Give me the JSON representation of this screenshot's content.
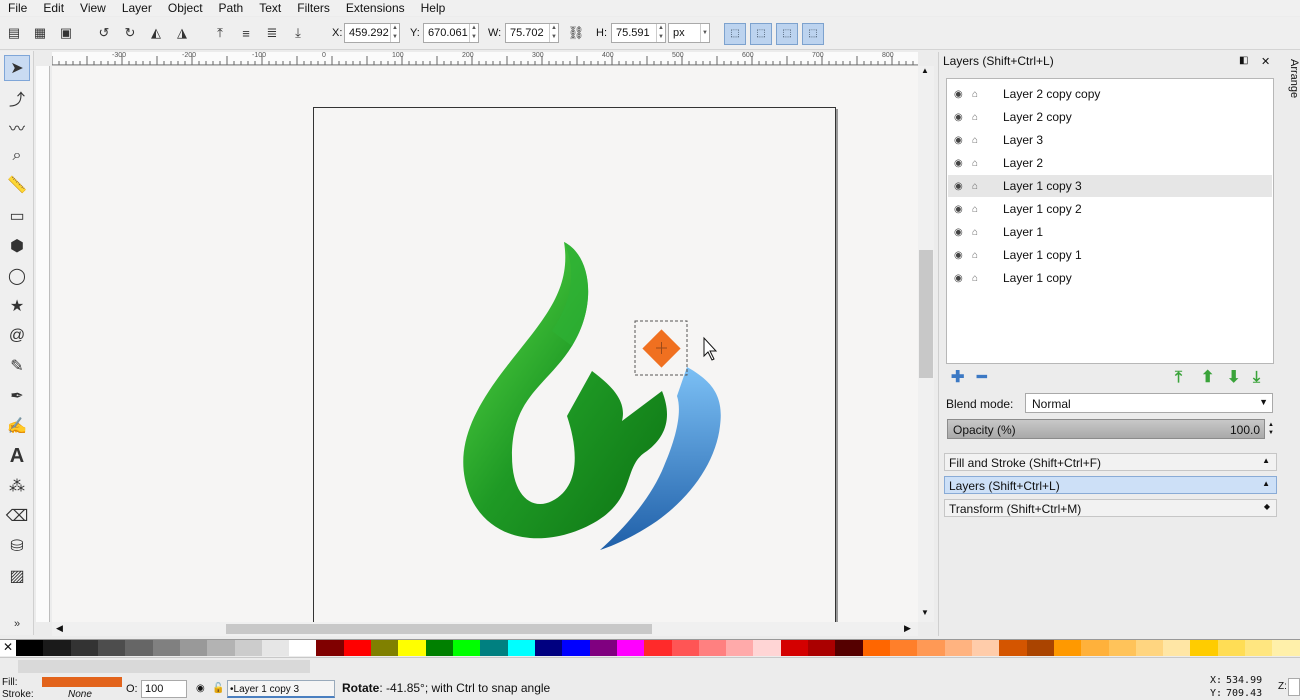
{
  "menu": [
    "File",
    "Edit",
    "View",
    "Layer",
    "Object",
    "Path",
    "Text",
    "Filters",
    "Extensions",
    "Help"
  ],
  "toolbar": {
    "x_label": "X:",
    "x_value": "459.292",
    "y_label": "Y:",
    "y_value": "670.061",
    "w_label": "W:",
    "w_value": "75.702",
    "h_label": "H:",
    "h_value": "75.591",
    "unit": "px"
  },
  "ruler_marks": [
    "-300",
    "-200",
    "-100",
    "0",
    "100",
    "200",
    "300",
    "400",
    "500",
    "600",
    "700",
    "800"
  ],
  "layers_panel": {
    "title": "Layers (Shift+Ctrl+L)",
    "layers": [
      "Layer 2 copy copy",
      "Layer 2 copy",
      "Layer 3",
      "Layer 2",
      "Layer 1 copy 3",
      "Layer 1 copy 2",
      "Layer 1",
      "Layer 1 copy 1",
      "Layer 1 copy"
    ],
    "selected_index": 4,
    "blend_label": "Blend mode:",
    "blend_value": "Normal",
    "opacity_label": "Opacity (%)",
    "opacity_value": "100.0"
  },
  "dock_sections": [
    {
      "label": "Fill and Stroke (Shift+Ctrl+F)",
      "open": false
    },
    {
      "label": "Layers (Shift+Ctrl+L)",
      "open": true
    },
    {
      "label": "Transform (Shift+Ctrl+M)",
      "open": false
    }
  ],
  "arrange_tab": "Arrange",
  "palette": [
    "#000000",
    "#1a1a1a",
    "#333333",
    "#4d4d4d",
    "#666666",
    "#808080",
    "#999999",
    "#b3b3b3",
    "#cccccc",
    "#e6e6e6",
    "#ffffff",
    "#800000",
    "#ff0000",
    "#808000",
    "#ffff00",
    "#008000",
    "#00ff00",
    "#008080",
    "#00ffff",
    "#000080",
    "#0000ff",
    "#800080",
    "#ff00ff",
    "#ff2a2a",
    "#ff5555",
    "#ff8080",
    "#ffaaaa",
    "#ffd5d5",
    "#d40000",
    "#aa0000",
    "#550000",
    "#ff6600",
    "#ff7f2a",
    "#ff9955",
    "#ffb380",
    "#ffccaa",
    "#d45500",
    "#aa4400",
    "#ff9900",
    "#ffb13b",
    "#ffc35a",
    "#ffd580",
    "#ffe6a5",
    "#ffcc00",
    "#ffdd55",
    "#ffe680",
    "#fff0aa"
  ],
  "status": {
    "fill_label": "Fill:",
    "stroke_label": "Stroke:",
    "stroke_value": "None",
    "fill_color": "#e2631b",
    "opacity_label": "O:",
    "opacity_value": "100",
    "layer_value": "•Layer 1 copy 3",
    "message_bold": "Rotate",
    "message": ": -41.85°; with Ctrl to snap angle",
    "x_label": "X:",
    "x_value": "534.99",
    "y_label": "Y:",
    "y_value": "709.43",
    "z_label": "Z:"
  },
  "colors": {
    "green": "#1f9a25",
    "blue": "#3d8fdc",
    "orange": "#f07020",
    "selection": "#c9dbf2"
  },
  "tools": [
    "arrow-icon",
    "node-icon",
    "tweak-icon",
    "zoom-icon",
    "measure-icon",
    "rect-icon",
    "box3d-icon",
    "circle-icon",
    "star-icon",
    "spiral-icon",
    "pencil-icon",
    "pen-icon",
    "calligraphy-icon",
    "text-icon",
    "spray-icon",
    "eraser-icon",
    "bucket-icon",
    "gradient-icon"
  ]
}
